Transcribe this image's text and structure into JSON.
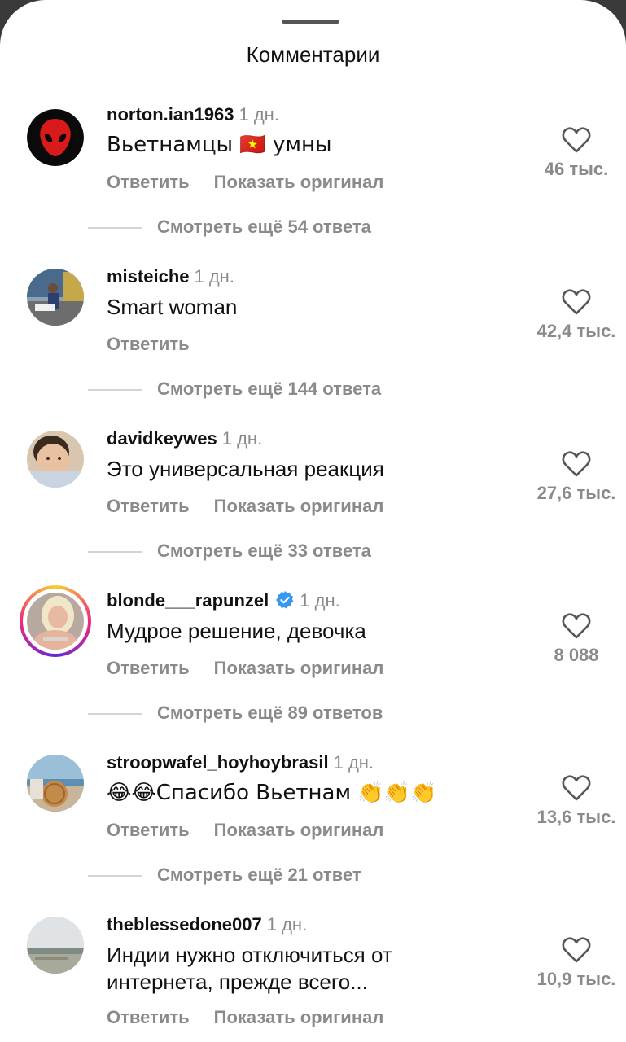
{
  "title": "Комментарии",
  "reply_label": "Ответить",
  "translate_label": "Показать оригинал",
  "comments": [
    {
      "username": "norton.ian1963",
      "time": "1 дн.",
      "text": "Вьетнамцы 🇻🇳 умны",
      "likes": "46 тыс.",
      "more_replies": "Смотреть ещё 54 ответа",
      "avatar_icon": "alien-icon"
    },
    {
      "username": "misteiche",
      "time": "1 дн.",
      "text": "Smart woman",
      "likes": "42,4 тыс.",
      "more_replies": "Смотреть ещё 144 ответа",
      "avatar_icon": "photo-avatar"
    },
    {
      "username": "davidkeywes",
      "time": "1 дн.",
      "text": "Это универсальная реакция",
      "likes": "27,6 тыс.",
      "more_replies": "Смотреть ещё 33 ответа",
      "avatar_icon": "photo-avatar"
    },
    {
      "username": "blonde___rapunzel",
      "time": "1 дн.",
      "text": "Мудрое решение, девочка",
      "likes": "8 088",
      "more_replies": "Смотреть ещё 89 ответов",
      "avatar_icon": "photo-avatar"
    },
    {
      "username": "stroopwafel_hoyhoybrasil",
      "time": "1 дн.",
      "text": "😂😂Спасибо Вьетнам 👏👏👏",
      "likes": "13,6 тыс.",
      "more_replies": "Смотреть ещё 21 ответ",
      "avatar_icon": "photo-avatar"
    },
    {
      "username": "theblessedone007",
      "time": "1 дн.",
      "text_line1": "Индии нужно отключиться от",
      "text_line2": "интернета, прежде всего...",
      "likes": "10,9 тыс.",
      "avatar_icon": "photo-avatar"
    }
  ],
  "colors": {
    "accent_verified": "#3897f0",
    "secondary_text": "#8a8a8a"
  }
}
